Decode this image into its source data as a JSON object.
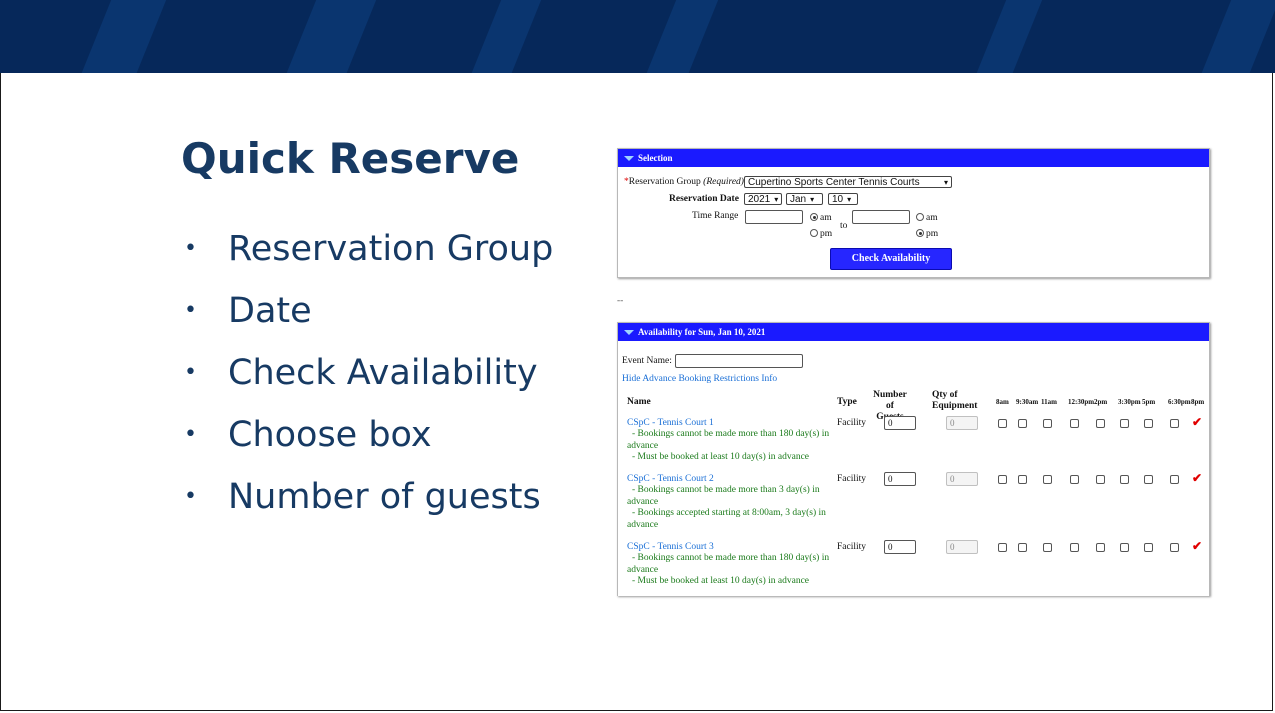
{
  "slide": {
    "title": "Quick Reserve",
    "bullets": [
      "Reservation Group",
      "Date",
      "Check Availability",
      "Choose box",
      "Number of guests"
    ]
  },
  "selection": {
    "header": "Selection",
    "group_label_star": "*",
    "group_label": "Reservation Group",
    "group_required": "(Required)",
    "group_value": "Cupertino Sports Center Tennis Courts",
    "date_label": "Reservation Date",
    "year": "2021",
    "month": "Jan",
    "day": "10",
    "time_label": "Time Range",
    "am": "am",
    "pm": "pm",
    "to": "to",
    "button": "Check Availability"
  },
  "separator": "--",
  "availability": {
    "header": "Availability for Sun, Jan 10, 2021",
    "event_label": "Event Name:",
    "hide_link": "Hide Advance Booking Restrictions Info",
    "col_name": "Name",
    "col_type": "Type",
    "col_guests_1": "Number of",
    "col_guests_2": "Guests",
    "col_qty_1": "Qty of",
    "col_qty_2": "Equipment",
    "times": [
      "8am",
      "9:30am",
      "11am",
      "12:30pm",
      "2pm",
      "3:30pm",
      "5pm",
      "6:30pm",
      "8pm"
    ],
    "rows": [
      {
        "name": "CSpC - Tennis Court 1",
        "type": "Facility",
        "guests": "0",
        "qty": "0",
        "lines": [
          "- Bookings cannot be made more than 180 day(s) in",
          "advance",
          "- Must be booked at least 10 day(s) in advance"
        ]
      },
      {
        "name": "CSpC - Tennis Court 2",
        "type": "Facility",
        "guests": "0",
        "qty": "0",
        "lines": [
          "- Bookings cannot be made more than 3 day(s) in",
          "advance",
          "- Bookings accepted starting at 8:00am, 3 day(s) in",
          "advance"
        ]
      },
      {
        "name": "CSpC - Tennis Court 3",
        "type": "Facility",
        "guests": "0",
        "qty": "0",
        "lines": [
          "- Bookings cannot be made more than 180 day(s) in",
          "advance",
          "- Must be booked at least 10 day(s) in advance"
        ]
      }
    ],
    "unavailable_mark": "✔"
  }
}
